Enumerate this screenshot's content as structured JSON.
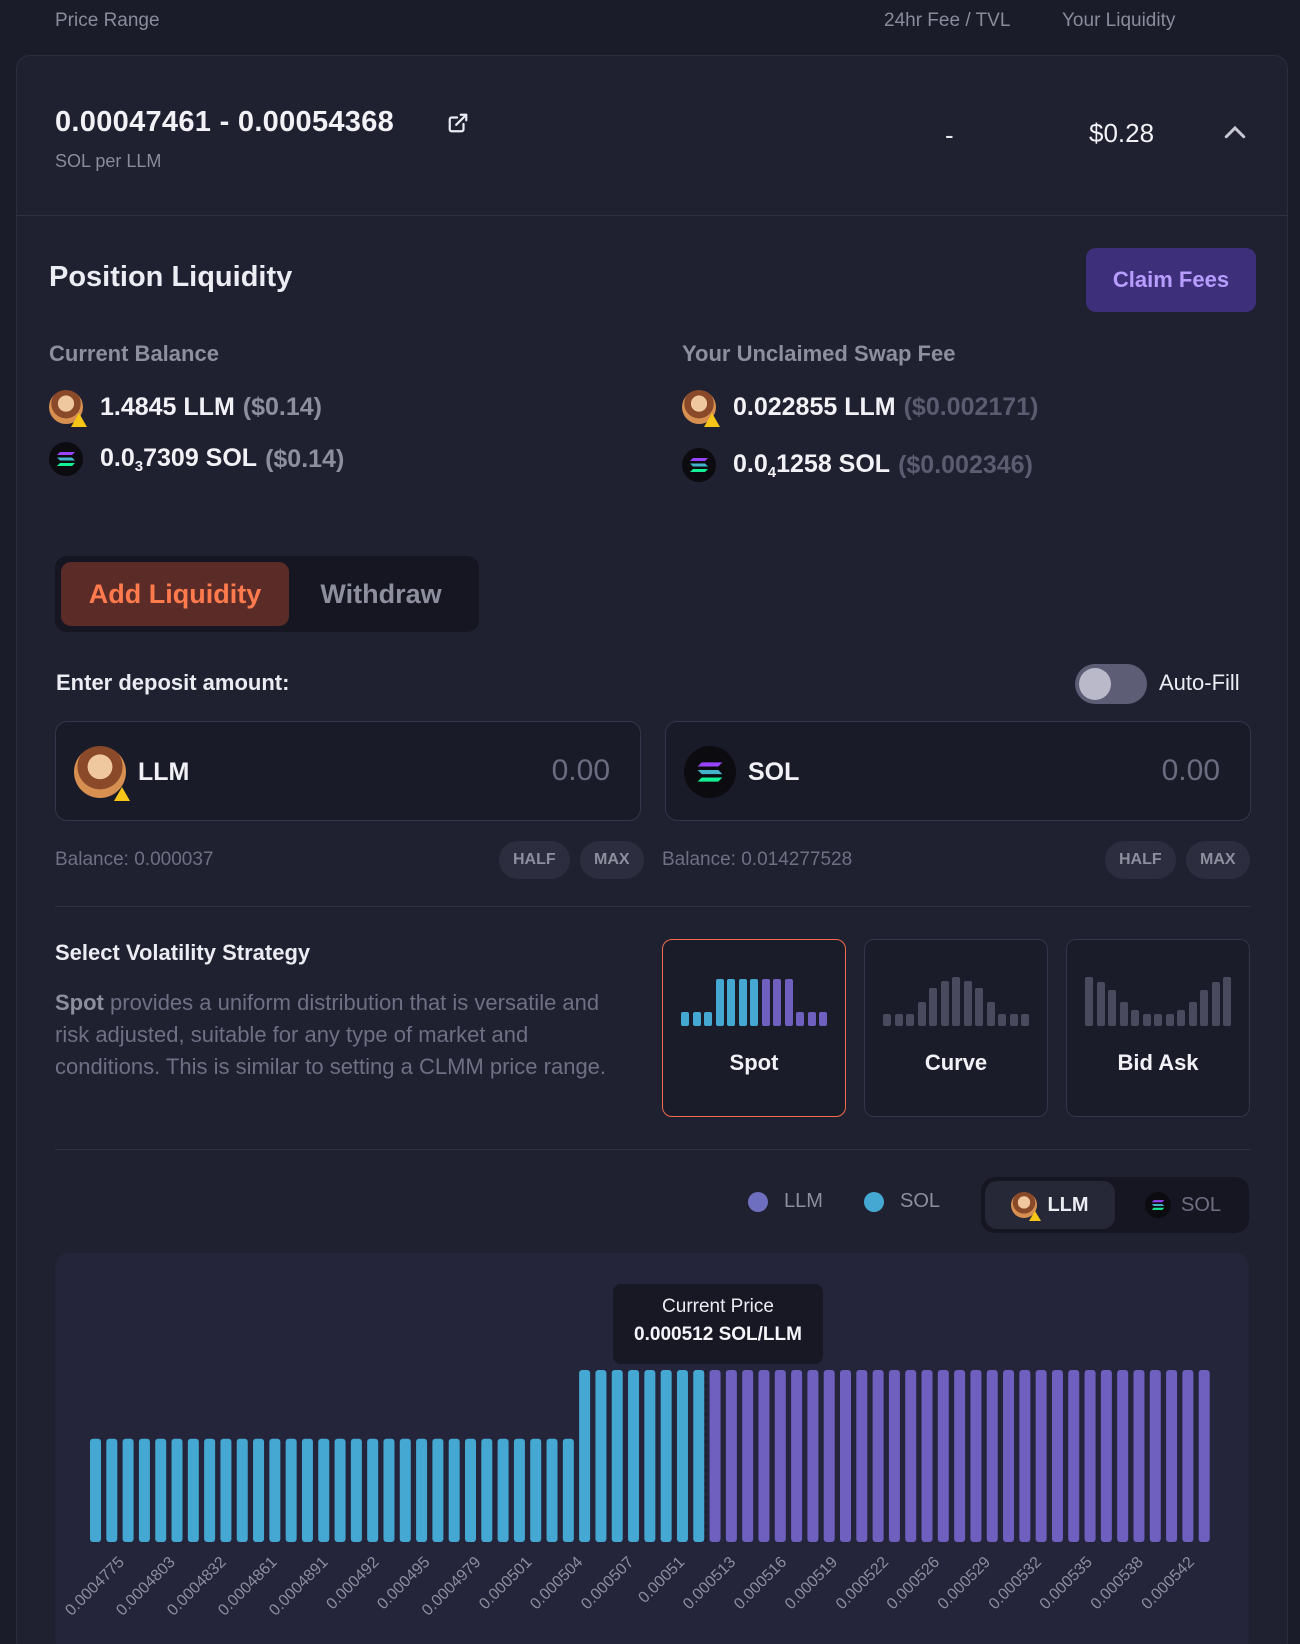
{
  "header": {
    "col_price_range": "Price Range",
    "col_fee_tvl": "24hr Fee / TVL",
    "col_liquidity": "Your Liquidity"
  },
  "position": {
    "range": "0.00047461 - 0.00054368",
    "unit": "SOL per LLM",
    "fee_tvl": "-",
    "liquidity": "$0.28"
  },
  "liquidity_panel": {
    "title": "Position Liquidity",
    "claim_label": "Claim Fees",
    "current_balance_label": "Current Balance",
    "unclaimed_label": "Your Unclaimed Swap Fee",
    "current_balance": [
      {
        "amount": "1.4845 LLM",
        "usd": "($0.14)"
      },
      {
        "amount_pre": "0.0",
        "amount_sub": "3",
        "amount_post": "7309 SOL",
        "usd": "($0.14)"
      }
    ],
    "unclaimed": [
      {
        "amount": "0.022855 LLM",
        "usd": "($0.002171)"
      },
      {
        "amount_pre": "0.0",
        "amount_sub": "4",
        "amount_post": "1258 SOL",
        "usd": "($0.002346)"
      }
    ]
  },
  "tabs": {
    "add": "Add Liquidity",
    "withdraw": "Withdraw"
  },
  "deposit": {
    "label": "Enter deposit amount:",
    "autofill_label": "Auto-Fill",
    "autofill_on": false,
    "inputs": [
      {
        "token": "LLM",
        "placeholder": "0.00",
        "balance": "Balance: 0.000037",
        "half": "HALF",
        "max": "MAX"
      },
      {
        "token": "SOL",
        "placeholder": "0.00",
        "balance": "Balance: 0.014277528",
        "half": "HALF",
        "max": "MAX"
      }
    ]
  },
  "strategy": {
    "title": "Select Volatility Strategy",
    "desc_bold": "Spot",
    "desc_rest": " provides a uniform distribution that is versatile and risk adjusted, suitable for any type of market and conditions. This is similar to setting a CLMM price range.",
    "options": [
      "Spot",
      "Curve",
      "Bid Ask"
    ],
    "selected": "Spot"
  },
  "legend": {
    "llm": "LLM",
    "sol": "SOL",
    "seg_llm": "LLM",
    "seg_sol": "SOL"
  },
  "colors": {
    "llm": "#6f5fbf",
    "sol": "#45a8d2",
    "accent": "#f06b4a",
    "claim": "#b79dff"
  },
  "tooltip": {
    "title": "Current Price",
    "value": "0.000512 SOL/LLM"
  },
  "chart_data": {
    "type": "bar",
    "current_bin": 38,
    "sol_bins": 38,
    "llm_bins": 30,
    "values": [
      0.6,
      0.6,
      0.6,
      0.6,
      0.6,
      0.6,
      0.6,
      0.6,
      0.6,
      0.6,
      0.6,
      0.6,
      0.6,
      0.6,
      0.6,
      0.6,
      0.6,
      0.6,
      0.6,
      0.6,
      0.6,
      0.6,
      0.6,
      0.6,
      0.6,
      0.6,
      0.6,
      0.6,
      0.6,
      0.6,
      1,
      1,
      1,
      1,
      1,
      1,
      1,
      1,
      1,
      1,
      1,
      1,
      1,
      1,
      1,
      1,
      1,
      1,
      1,
      1,
      1,
      1,
      1,
      1,
      1,
      1,
      1,
      1,
      1,
      1,
      1,
      1,
      1,
      1,
      1,
      1,
      1,
      1,
      1
    ],
    "x_tick_labels": [
      "0.0004775",
      "0.0004803",
      "0.0004832",
      "0.0004861",
      "0.0004891",
      "0.000492",
      "0.000495",
      "0.0004979",
      "0.000501",
      "0.000504",
      "0.000507",
      "0.00051",
      "0.000513",
      "0.000516",
      "0.000519",
      "0.000522",
      "0.000526",
      "0.000529",
      "0.000532",
      "0.000535",
      "0.000538",
      "0.000542"
    ]
  }
}
